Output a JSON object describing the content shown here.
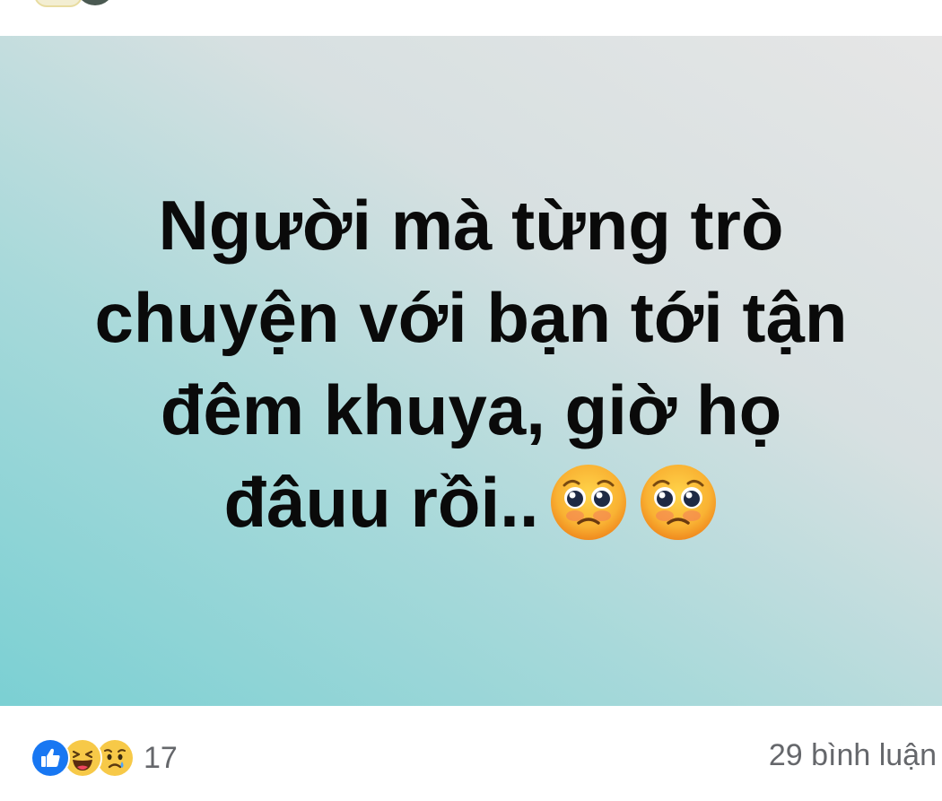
{
  "post": {
    "text": "Người mà từng trò chuyện với bạn tới tận đêm khuya, giờ họ đâuu rồi..",
    "emojis": [
      "pleading-face-emoji",
      "pleading-face-emoji"
    ],
    "background_gradient": [
      "#7bd0d3",
      "#e6e6e6"
    ]
  },
  "footer": {
    "reactions": [
      "like-icon",
      "haha-icon",
      "sad-icon"
    ],
    "reaction_count": "17",
    "comment_count": "29 bình luận"
  },
  "colors": {
    "like_blue": "#1877f2",
    "emoji_yellow": "#f7c948",
    "secondary_text": "#65676b"
  }
}
